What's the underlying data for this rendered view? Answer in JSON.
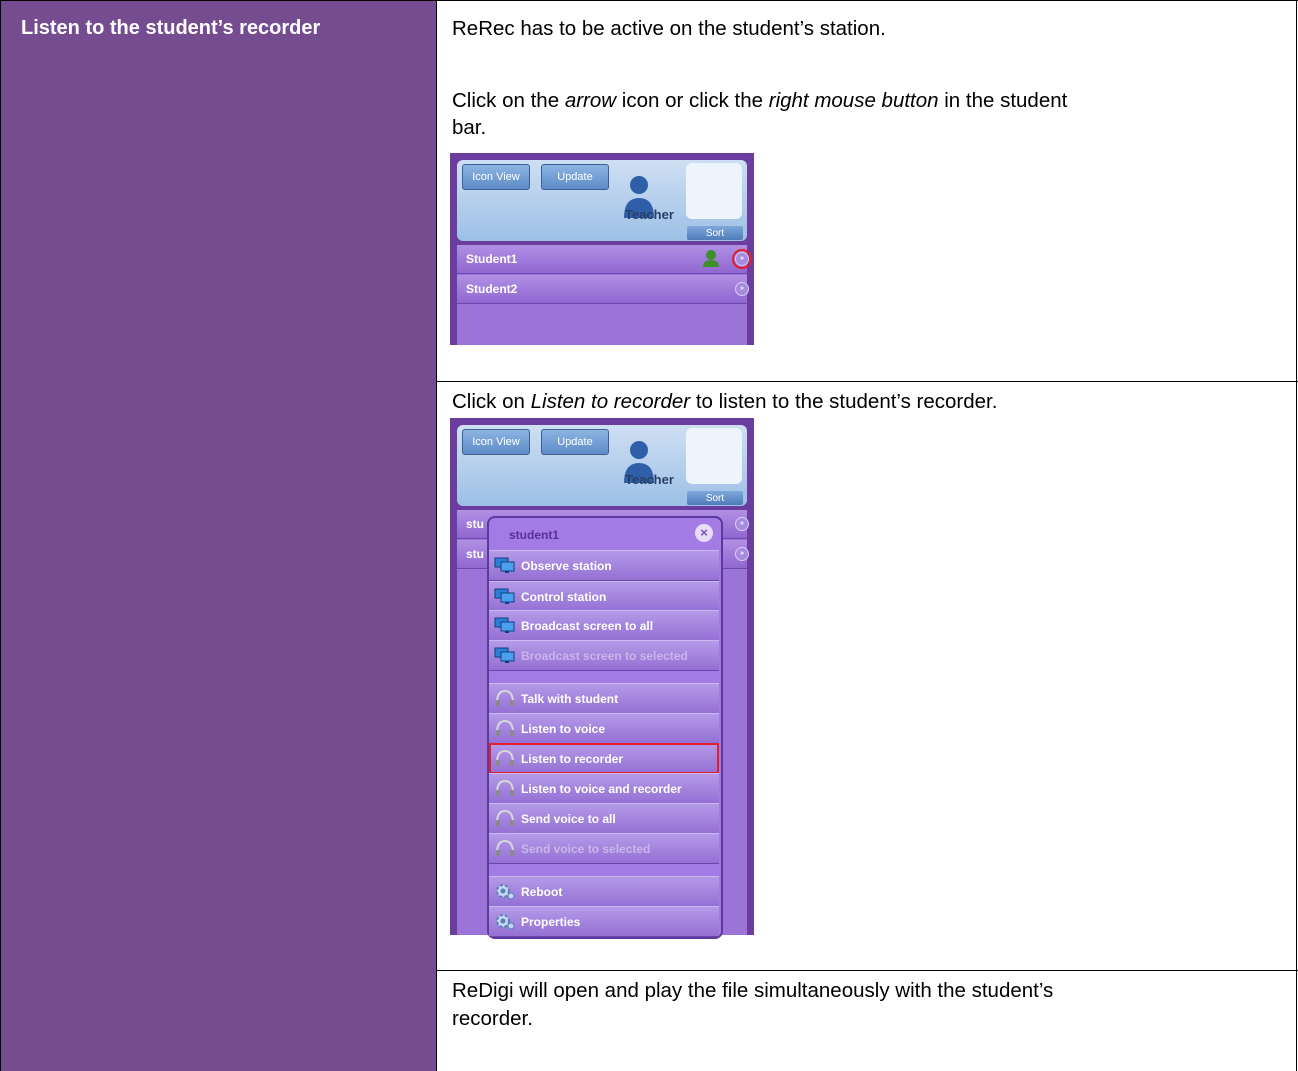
{
  "left_title": "Listen to the student’s recorder",
  "row1": {
    "line1": "ReRec has to be active on the student’s station.",
    "line2_pre": "Click on the ",
    "line2_em1": "arrow",
    "line2_mid": " icon or click the ",
    "line2_em2": "right mouse button",
    "line2_post": " in the student",
    "line3": "bar."
  },
  "row2": {
    "pre": "Click on ",
    "em": "Listen to recorder",
    "post": " to listen to the student’s recorder."
  },
  "row3": {
    "line1": "ReDigi will open and play the file simultaneously with the student’s",
    "line2": "recorder."
  },
  "widget1": {
    "icon_view": "Icon View",
    "update": "Update",
    "teacher": "Teacher",
    "sort": "Sort",
    "students": [
      "Student1",
      "Student2"
    ]
  },
  "widget2": {
    "icon_view": "Icon View",
    "update": "Update",
    "teacher": "Teacher",
    "sort": "Sort",
    "row_stub": [
      "stu",
      "stu"
    ],
    "menu_title": "student1",
    "items": [
      {
        "label": "Observe station",
        "icon": "monitor-icon",
        "disabled": false
      },
      {
        "label": "Control station",
        "icon": "monitor-icon",
        "disabled": false
      },
      {
        "label": "Broadcast screen to all",
        "icon": "monitor-icon",
        "disabled": false
      },
      {
        "label": "Broadcast screen to selected",
        "icon": "monitor-icon",
        "disabled": true
      },
      {
        "label": "Talk with student",
        "icon": "headphones-icon",
        "disabled": false
      },
      {
        "label": "Listen to voice",
        "icon": "headphones-icon",
        "disabled": false
      },
      {
        "label": "Listen to recorder",
        "icon": "headphones-icon",
        "disabled": false,
        "highlighted": true
      },
      {
        "label": "Listen to voice and recorder",
        "icon": "headphones-icon",
        "disabled": false
      },
      {
        "label": "Send voice to all",
        "icon": "headphones-icon",
        "disabled": false
      },
      {
        "label": "Send voice to selected",
        "icon": "headphones-icon",
        "disabled": true
      },
      {
        "label": "Reboot",
        "icon": "gear-icon",
        "disabled": false
      },
      {
        "label": "Properties",
        "icon": "gear-icon",
        "disabled": false
      }
    ]
  },
  "colors": {
    "left_cell": "#764c91",
    "highlight": "#e2202c"
  }
}
